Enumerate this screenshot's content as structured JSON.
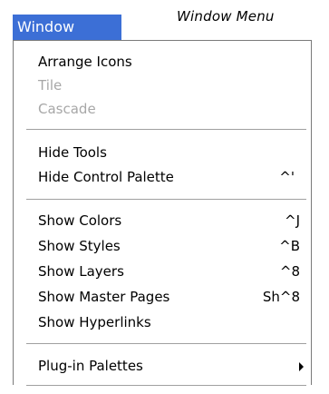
{
  "caption": "Window Menu",
  "menubar": {
    "window_label": "Window"
  },
  "menu": {
    "items": [
      {
        "label": "Arrange Icons",
        "accel": "",
        "disabled": false
      },
      {
        "label": "Tile",
        "accel": "",
        "disabled": true
      },
      {
        "label": "Cascade",
        "accel": "",
        "disabled": true
      },
      {
        "label": "Hide Tools",
        "accel": "",
        "disabled": false
      },
      {
        "label": "Hide Control Palette",
        "accel": "^'",
        "disabled": false
      },
      {
        "label": "Show Colors",
        "accel": "^J",
        "disabled": false
      },
      {
        "label": "Show Styles",
        "accel": "^B",
        "disabled": false
      },
      {
        "label": "Show Layers",
        "accel": "^8",
        "disabled": false
      },
      {
        "label": "Show Master Pages",
        "accel": "Sh^8",
        "disabled": false
      },
      {
        "label": "Show Hyperlinks",
        "accel": "",
        "disabled": false
      },
      {
        "label": "Plug-in Palettes",
        "accel": "",
        "disabled": false,
        "submenu": true
      }
    ]
  }
}
